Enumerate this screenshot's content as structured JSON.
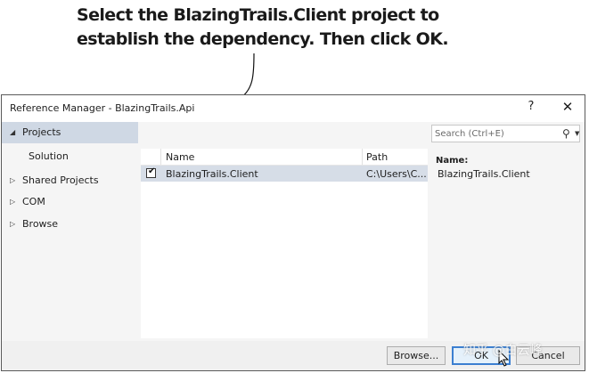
{
  "callout": {
    "line1": "Select the BlazingTrails.Client project to",
    "line2": "establish the dependency. Then click OK."
  },
  "dialog": {
    "title": "Reference Manager - BlazingTrails.Api",
    "help_label": "?",
    "close_label": "✕"
  },
  "nav": {
    "items": [
      {
        "label": "Projects",
        "expander": "◢",
        "expanded": true
      },
      {
        "label": "Solution"
      },
      {
        "label": "Shared Projects",
        "expander": "▷"
      },
      {
        "label": "COM",
        "expander": "▷"
      },
      {
        "label": "Browse",
        "expander": "▷"
      }
    ]
  },
  "list": {
    "columns": {
      "name": "Name",
      "path": "Path"
    },
    "rows": [
      {
        "checked": true,
        "check_glyph": "✔",
        "name": "BlazingTrails.Client",
        "path": "C:\\Users\\C..."
      }
    ]
  },
  "search": {
    "placeholder": "Search (Ctrl+E)",
    "icon": "search-icon",
    "icon_glyph": "⚲",
    "dropdown_glyph": "▼"
  },
  "details": {
    "name_label": "Name:",
    "name_value": "BlazingTrails.Client"
  },
  "buttons": {
    "browse": "Browse...",
    "ok": "OK",
    "cancel": "Cancel"
  },
  "watermark": "知乎 @白云峰",
  "colors": {
    "selection": "#cfd8e4",
    "row_selection": "#d6dde7",
    "ok_border": "#3b7fd1"
  }
}
